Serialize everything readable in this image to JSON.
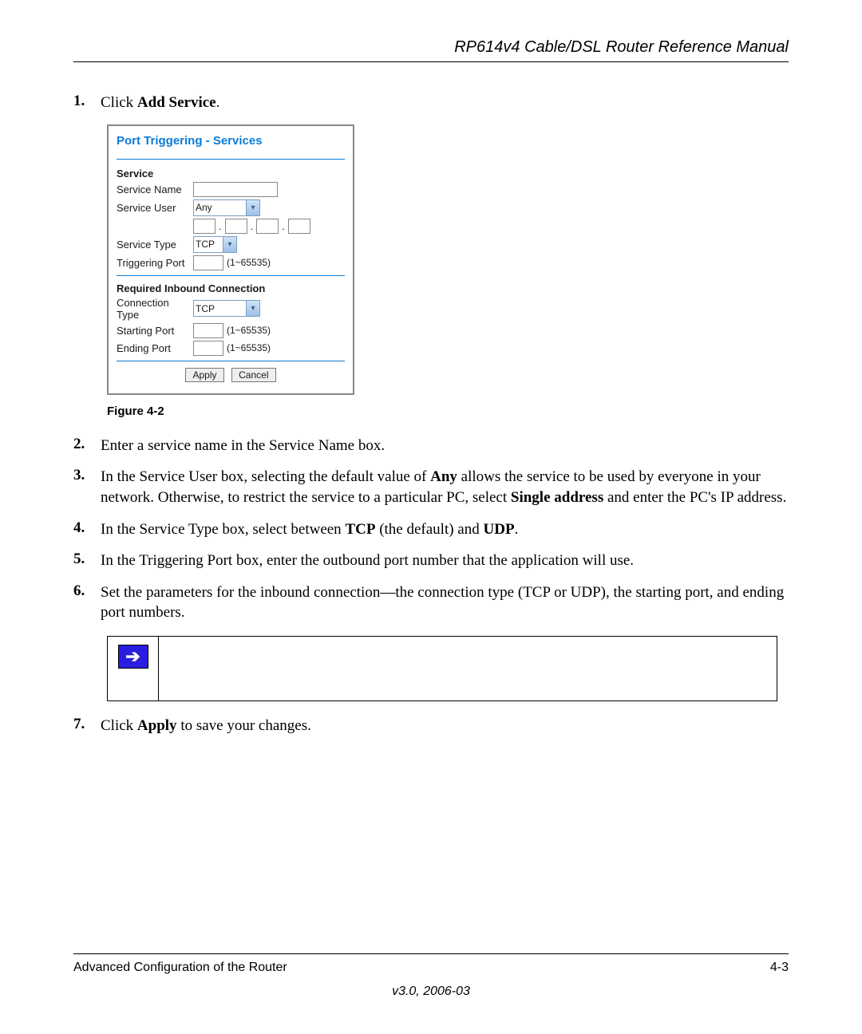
{
  "header": {
    "title": "RP614v4 Cable/DSL Router Reference Manual"
  },
  "steps": {
    "s1": {
      "num": "1.",
      "pre": "Click ",
      "bold": "Add Service",
      "post": "."
    },
    "s2": {
      "num": "2.",
      "text": "Enter a service name in the Service Name box."
    },
    "s3": {
      "num": "3.",
      "pre": "In the Service User box, selecting the default value of ",
      "b1": "Any",
      "mid": " allows the service to be used by everyone in your network. Otherwise, to restrict the service to a particular PC, select ",
      "b2": "Single address",
      "post": " and enter the PC's IP address."
    },
    "s4": {
      "num": "4.",
      "pre": "In the Service Type box, select between ",
      "b1": "TCP",
      "mid": " (the default) and ",
      "b2": "UDP",
      "post": "."
    },
    "s5": {
      "num": "5.",
      "text": "In the Triggering Port box, enter the outbound port number that the application will use."
    },
    "s6": {
      "num": "6.",
      "text": "Set the parameters for the inbound connection—the connection type (TCP or UDP), the starting port, and ending port numbers."
    },
    "s7": {
      "num": "7.",
      "pre": "Click ",
      "b1": "Apply",
      "post": " to save your changes."
    }
  },
  "dialog": {
    "title": "Port Triggering - Services",
    "service_head": "Service",
    "service_name_label": "Service Name",
    "service_user_label": "Service User",
    "service_user_value": "Any",
    "service_type_label": "Service Type",
    "service_type_value": "TCP",
    "triggering_port_label": "Triggering Port",
    "port_hint": "(1~65535)",
    "inbound_head": "Required Inbound Connection",
    "conn_type_label": "Connection Type",
    "conn_type_value": "TCP",
    "starting_port_label": "Starting Port",
    "ending_port_label": "Ending Port",
    "apply_btn": "Apply",
    "cancel_btn": "Cancel",
    "dot": "."
  },
  "figure_caption": "Figure 4-2",
  "note_icon": "➔",
  "footer": {
    "left": "Advanced Configuration of the Router",
    "right": "4-3",
    "version": "v3.0, 2006-03"
  }
}
